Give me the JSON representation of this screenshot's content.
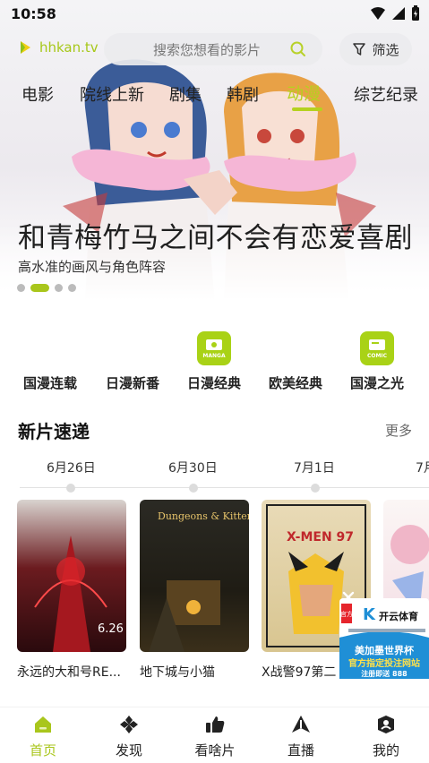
{
  "status_bar": {
    "time": "10:58"
  },
  "header": {
    "logo_text": "hhkan.tv",
    "search_placeholder": "搜索您想看的影片",
    "filter_label": "筛选"
  },
  "tabs": [
    {
      "label": "电影"
    },
    {
      "label": "院线上新"
    },
    {
      "label": "剧集"
    },
    {
      "label": "韩剧"
    },
    {
      "label": "动漫",
      "active": true
    },
    {
      "label": "综艺纪录"
    }
  ],
  "hero": {
    "title": "和青梅竹马之间不会有恋爱喜剧",
    "subtitle": "高水准的画风与角色阵容",
    "slide_count": 4,
    "active_slide": 1
  },
  "quick_entries": [
    {
      "label": "国漫连载"
    },
    {
      "label": "日漫新番"
    },
    {
      "label": "日漫经典",
      "badge": "MANGA"
    },
    {
      "label": "欧美经典"
    },
    {
      "label": "国漫之光",
      "badge": "COMIC"
    }
  ],
  "new_releases": {
    "title": "新片速递",
    "more_label": "更多",
    "dates": [
      "6月26日",
      "6月30日",
      "7月1日",
      "7月"
    ],
    "items": [
      {
        "title": "永远的大和号RE...",
        "poster_text": "6.26"
      },
      {
        "title": "地下城与小猫",
        "poster_text": "Dungeons & Kittens"
      },
      {
        "title": "X战警97第二",
        "poster_text": "X-MEN 97"
      },
      {
        "title": ""
      }
    ]
  },
  "ad": {
    "brand": "开云体育",
    "line1": "美加墨世界杯",
    "line2": "官方指定投注网站",
    "line3": "注册即送 888",
    "tag": "官方"
  },
  "bottom_nav": [
    {
      "label": "首页",
      "active": true
    },
    {
      "label": "发现"
    },
    {
      "label": "看啥片"
    },
    {
      "label": "直播"
    },
    {
      "label": "我的"
    }
  ],
  "colors": {
    "accent": "#a9c61c"
  }
}
